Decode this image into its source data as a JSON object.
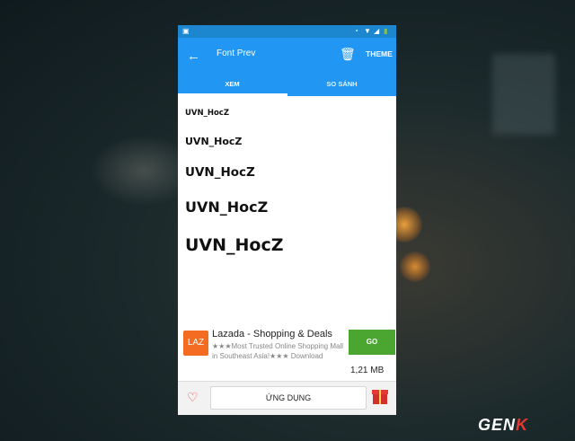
{
  "toolbar": {
    "title": "Font Prev",
    "theme_label": "THEME"
  },
  "tabs": [
    {
      "label": "XEM"
    },
    {
      "label": "SO SÁNH"
    }
  ],
  "preview_samples": [
    {
      "text": "UVN_HocZ"
    },
    {
      "text": "UVN_HocZ"
    },
    {
      "text": "UVN_HocZ"
    },
    {
      "text": "UVN_HocZ"
    },
    {
      "text": "UVN_HocZ"
    }
  ],
  "ad": {
    "logo_text": "LAZ",
    "title": "Lazada - Shopping & Deals",
    "description": "★★★Most Trusted Online Shopping Mall in Southeast Asia!★★★ Download",
    "button_label": "GO",
    "size": "1,21 MB"
  },
  "bottom": {
    "app_button_label": "ỨNG DỤNG"
  },
  "watermark": {
    "brand_main": "GEN",
    "brand_accent": "K"
  },
  "colors": {
    "primary": "#2196f3",
    "status": "#1c86cf",
    "go": "#4aa631",
    "heart": "#e53935"
  },
  "icons": [
    "back-arrow-icon",
    "trash-icon",
    "heart-icon",
    "gift-icon",
    "image-icon",
    "wifi-icon",
    "signal-icon",
    "battery-icon"
  ]
}
